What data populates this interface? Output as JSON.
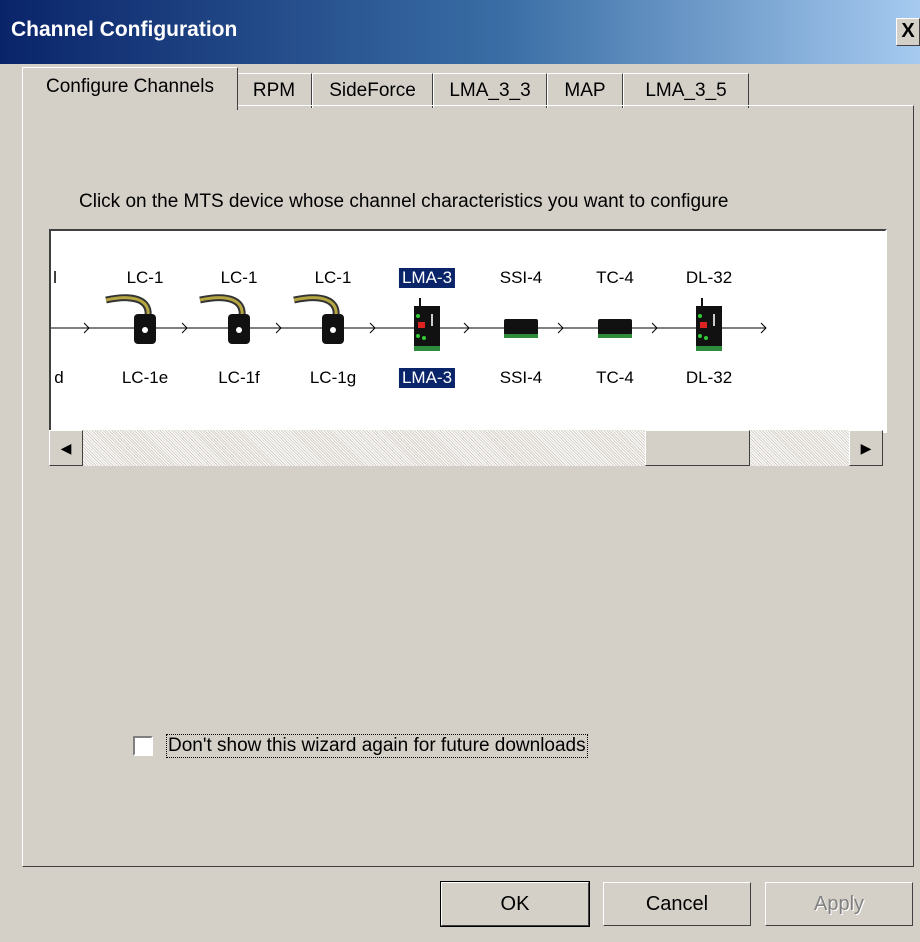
{
  "window": {
    "title": "Channel Configuration",
    "close_glyph": "X"
  },
  "tabs": [
    {
      "label": "Configure Channels",
      "active": true
    },
    {
      "label": "RPM"
    },
    {
      "label": "SideForce"
    },
    {
      "label": "LMA_3_3"
    },
    {
      "label": "MAP"
    },
    {
      "label": "LMA_3_5"
    }
  ],
  "instruction": "Click on the MTS device whose channel characteristics you want to configure",
  "chain": {
    "partial_top": "l",
    "partial_bottom": "d",
    "devices": [
      {
        "top": "LC-1",
        "bottom": "LC-1e",
        "icon": "lc1-sensor-icon",
        "selected": false
      },
      {
        "top": "LC-1",
        "bottom": "LC-1f",
        "icon": "lc1-sensor-icon",
        "selected": false
      },
      {
        "top": "LC-1",
        "bottom": "LC-1g",
        "icon": "lc1-sensor-icon",
        "selected": false
      },
      {
        "top": "LMA-3",
        "bottom": "LMA-3",
        "icon": "lma3-module-icon",
        "selected": true
      },
      {
        "top": "SSI-4",
        "bottom": "SSI-4",
        "icon": "ssi4-module-icon",
        "selected": false
      },
      {
        "top": "TC-4",
        "bottom": "TC-4",
        "icon": "tc4-module-icon",
        "selected": false
      },
      {
        "top": "DL-32",
        "bottom": "DL-32",
        "icon": "dl32-logger-icon",
        "selected": false
      }
    ]
  },
  "scrollbar": {
    "left_glyph": "◀",
    "right_glyph": "▶",
    "position": 0.85
  },
  "checkbox": {
    "label": "Don't show this wizard again for future downloads",
    "checked": false
  },
  "buttons": {
    "ok": "OK",
    "cancel": "Cancel",
    "apply": "Apply"
  },
  "colors": {
    "titlebar_start": "#0a246a",
    "selection": "#0a246a",
    "device_green": "#2e8b3c",
    "cable_tan": "#b5a642"
  }
}
